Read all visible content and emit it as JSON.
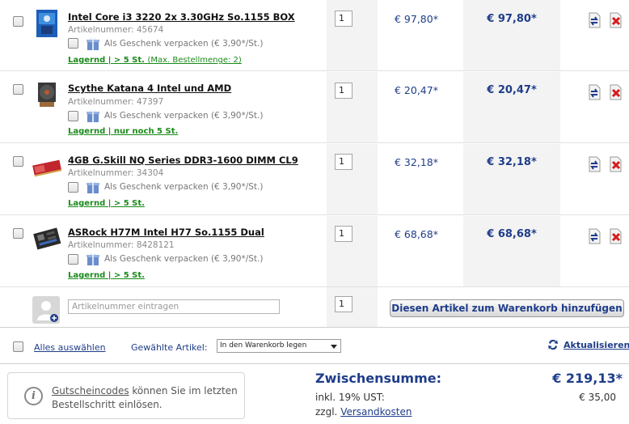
{
  "cart": {
    "items": [
      {
        "title": "Intel Core i3 3220 2x 3.30GHz So.1155 BOX",
        "artnr": "Artikelnummer: 45674",
        "gift": "Als Geschenk verpacken (€ 3,90*/St.)",
        "stock": "Lagernd | > 5 St.",
        "stock_note": "(Max. Bestellmenge: 2)",
        "qty": "1",
        "price": "€ 97,80*",
        "total": "€ 97,80*"
      },
      {
        "title": "Scythe Katana 4 Intel und AMD",
        "artnr": "Artikelnummer: 47397",
        "gift": "Als Geschenk verpacken (€ 3,90*/St.)",
        "stock": "Lagernd | nur noch 5 St.",
        "stock_note": "",
        "qty": "1",
        "price": "€ 20,47*",
        "total": "€ 20,47*"
      },
      {
        "title": "4GB G.Skill NQ Series DDR3-1600 DIMM CL9",
        "artnr": "Artikelnummer: 34304",
        "gift": "Als Geschenk verpacken (€ 3,90*/St.)",
        "stock": "Lagernd | > 5 St.",
        "stock_note": "",
        "qty": "1",
        "price": "€ 32,18*",
        "total": "€ 32,18*"
      },
      {
        "title": "ASRock H77M Intel H77 So.1155 Dual",
        "artnr": "Artikelnummer: 8428121",
        "gift": "Als Geschenk verpacken (€ 3,90*/St.)",
        "stock": "Lagernd | > 5 St.",
        "stock_note": "",
        "qty": "1",
        "price": "€ 68,68*",
        "total": "€ 68,68*"
      }
    ]
  },
  "add": {
    "placeholder": "Artikelnummer eintragen",
    "qty": "1",
    "button": "Diesen Artikel zum Warenkorb hinzufügen"
  },
  "toolbar": {
    "select_all": "Alles auswählen",
    "selected_label": "Gewählte Artikel:",
    "selected_action": "In den Warenkorb legen",
    "update": "Aktualisieren"
  },
  "voucher": {
    "link": "Gutscheincodes",
    "text": " können Sie im letzten Bestellschritt einlösen."
  },
  "summary": {
    "subtotal_label": "Zwischensumme:",
    "subtotal_value": "€ 219,13*",
    "vat_label": "inkl. 19% UST:",
    "vat_value": "€ 35,00",
    "shipping_prefix": "zzgl.",
    "shipping_link": "Versandkosten"
  },
  "colors": {
    "accent": "#1f3d8a",
    "stock": "#1a8a1a",
    "delete": "#d81c1c"
  }
}
